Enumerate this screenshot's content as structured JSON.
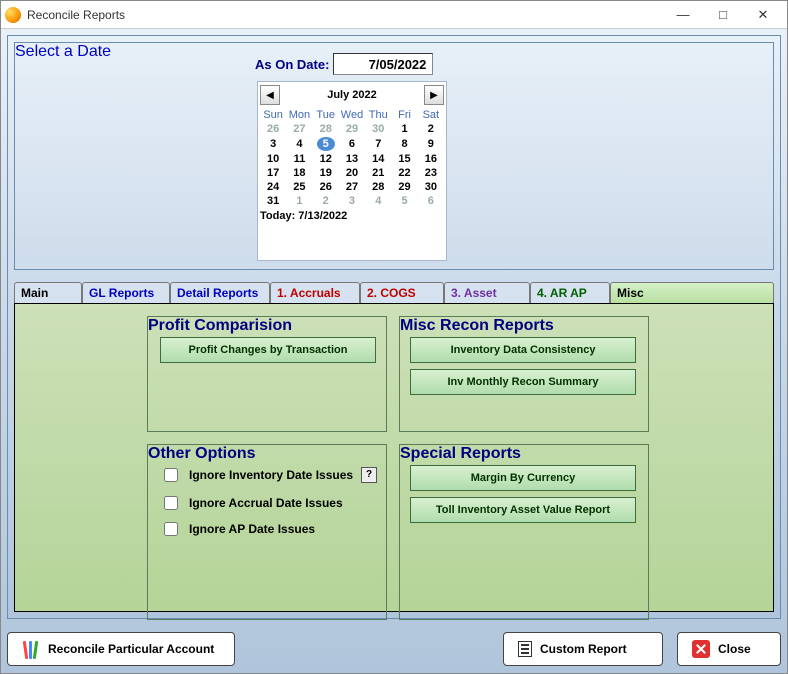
{
  "window": {
    "title": "Reconcile Reports"
  },
  "date_section": {
    "legend": "Select a Date",
    "as_on_label": "As On Date:",
    "as_on_value": "7/05/2022"
  },
  "calendar": {
    "month_label": "July 2022",
    "day_headers": [
      "Sun",
      "Mon",
      "Tue",
      "Wed",
      "Thu",
      "Fri",
      "Sat"
    ],
    "weeks": [
      [
        {
          "d": "26",
          "dim": true
        },
        {
          "d": "27",
          "dim": true
        },
        {
          "d": "28",
          "dim": true
        },
        {
          "d": "29",
          "dim": true
        },
        {
          "d": "30",
          "dim": true
        },
        {
          "d": "1"
        },
        {
          "d": "2"
        }
      ],
      [
        {
          "d": "3"
        },
        {
          "d": "4"
        },
        {
          "d": "5",
          "selected": true
        },
        {
          "d": "6"
        },
        {
          "d": "7"
        },
        {
          "d": "8"
        },
        {
          "d": "9"
        }
      ],
      [
        {
          "d": "10"
        },
        {
          "d": "11"
        },
        {
          "d": "12"
        },
        {
          "d": "13"
        },
        {
          "d": "14"
        },
        {
          "d": "15"
        },
        {
          "d": "16"
        }
      ],
      [
        {
          "d": "17"
        },
        {
          "d": "18"
        },
        {
          "d": "19"
        },
        {
          "d": "20"
        },
        {
          "d": "21"
        },
        {
          "d": "22"
        },
        {
          "d": "23"
        }
      ],
      [
        {
          "d": "24"
        },
        {
          "d": "25"
        },
        {
          "d": "26"
        },
        {
          "d": "27"
        },
        {
          "d": "28"
        },
        {
          "d": "29"
        },
        {
          "d": "30"
        }
      ],
      [
        {
          "d": "31"
        },
        {
          "d": "1",
          "dim": true
        },
        {
          "d": "2",
          "dim": true
        },
        {
          "d": "3",
          "dim": true
        },
        {
          "d": "4",
          "dim": true
        },
        {
          "d": "5",
          "dim": true
        },
        {
          "d": "6",
          "dim": true
        }
      ]
    ],
    "today_label": "Today: 7/13/2022"
  },
  "tabs": {
    "main": "Main",
    "gl": "GL Reports",
    "detail": "Detail Reports",
    "acc": "1. Accruals",
    "cogs": "2. COGS",
    "asset": "3. Asset",
    "arap": "4. AR AP",
    "misc": "Misc"
  },
  "groups": {
    "profit_legend": "Profit Comparision",
    "misc_legend": "Misc Recon Reports",
    "other_legend": "Other Options",
    "special_legend": "Special Reports"
  },
  "buttons": {
    "profit_changes": "Profit Changes by Transaction",
    "inv_consistency": "Inventory Data Consistency",
    "inv_monthly": "Inv Monthly Recon Summary",
    "margin_currency": "Margin By Currency",
    "toll_inv": "Toll Inventory Asset Value Report"
  },
  "options": {
    "ignore_inv": "Ignore Inventory Date Issues",
    "ignore_accrual": "Ignore Accrual Date Issues",
    "ignore_ap": "Ignore AP Date Issues",
    "help_char": "?"
  },
  "bottom": {
    "reconcile": "Reconcile Particular Account",
    "custom": "Custom Report",
    "close": "Close"
  }
}
